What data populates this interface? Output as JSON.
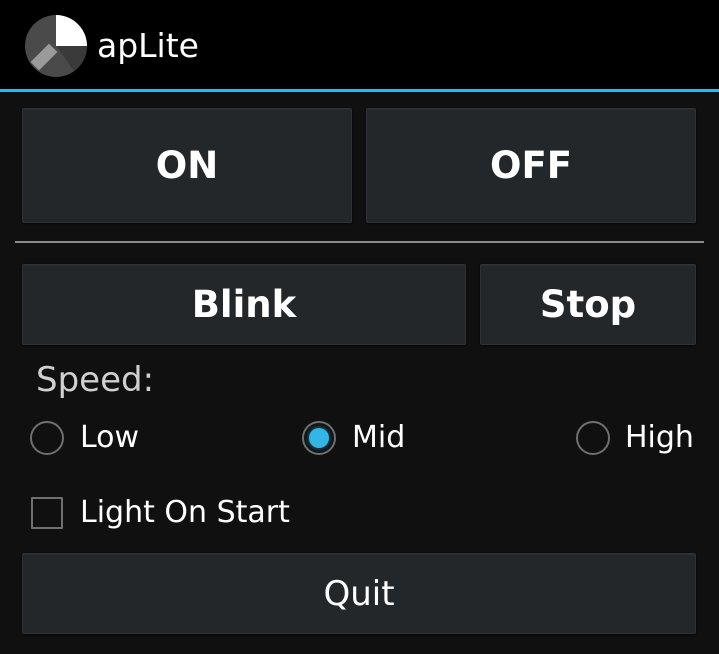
{
  "app": {
    "title": "apLite",
    "icon": "aplite-logo-icon",
    "accent_color": "#33b5e5"
  },
  "buttons": {
    "on": "ON",
    "off": "OFF",
    "blink": "Blink",
    "stop": "Stop",
    "quit": "Quit"
  },
  "speed": {
    "label": "Speed:",
    "options": [
      "Low",
      "Mid",
      "High"
    ],
    "selected": "Mid"
  },
  "light_on_start": {
    "label": "Light On Start",
    "checked": false
  }
}
